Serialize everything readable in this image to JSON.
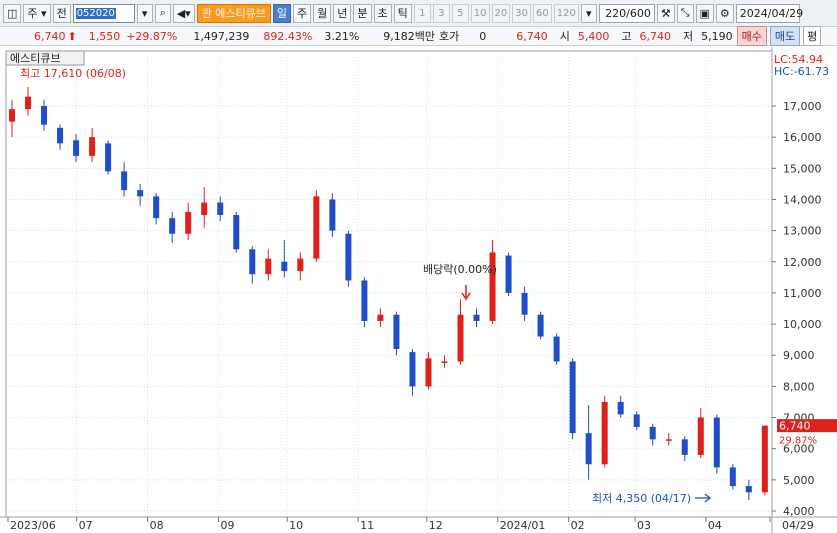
{
  "toolbar": {
    "type_label": "주",
    "market_label": "전",
    "code": "052020",
    "name_badge": "관",
    "name": "에스티큐브",
    "period_buttons": [
      "일",
      "주",
      "월",
      "년",
      "분",
      "초",
      "틱"
    ],
    "interval_buttons": [
      "1",
      "3",
      "5",
      "10",
      "20",
      "30",
      "60",
      "120"
    ],
    "count": "220",
    "count_max": "/600",
    "date": "2024/04/29"
  },
  "infobar": {
    "price": "6,740",
    "change": "1,550",
    "change_pct": "+29.87%",
    "volume": "1,497,239",
    "vol_ratio": "892.43%",
    "turnover": "3.21%",
    "amount": "9,182백만",
    "hoga_label": "호가",
    "hoga_value": "0",
    "current": "6,740",
    "open_label": "시",
    "open": "5,400",
    "high_label": "고",
    "high": "6,740",
    "low_label": "저",
    "low": "5,190",
    "buy_label": "매수",
    "sell_label": "매도",
    "more_label": "평"
  },
  "chart_data": {
    "type": "candlestick",
    "title": "에스티큐브",
    "ylim": [
      4000,
      17610
    ],
    "y_ticks": [
      4000,
      5000,
      6000,
      7000,
      8000,
      9000,
      10000,
      11000,
      12000,
      13000,
      14000,
      15000,
      16000,
      17000
    ],
    "y_tick_labels": [
      "4,000",
      "5,000",
      "6,000",
      "7,000",
      "8,000",
      "9,000",
      "10,000",
      "11,000",
      "12,000",
      "13,000",
      "14,000",
      "15,000",
      "16,000",
      "17,000"
    ],
    "x_labels": [
      "2023/06",
      "07",
      "08",
      "09",
      "10",
      "11",
      "12",
      "2024/01",
      "02",
      "03",
      "04",
      "04/29"
    ],
    "x_label_dates": [
      "2023-06-01",
      "2023-07-01",
      "2023-08-01",
      "2023-09-01",
      "2023-10-01",
      "2023-11-01",
      "2023-12-01",
      "2024-01-01",
      "2024-02-01",
      "2024-03-01",
      "2024-04-01",
      "2024-04-29"
    ],
    "grid": true,
    "up_color": "#e0201a",
    "down_color": "#1f4fc8",
    "candles": [
      {
        "date": "2023-06-01",
        "o": 16500,
        "h": 17200,
        "l": 16000,
        "c": 16900
      },
      {
        "date": "2023-06-08",
        "o": 16900,
        "h": 17610,
        "l": 16700,
        "c": 17300
      },
      {
        "date": "2023-06-15",
        "o": 17000,
        "h": 17200,
        "l": 16200,
        "c": 16400
      },
      {
        "date": "2023-06-22",
        "o": 16300,
        "h": 16400,
        "l": 15600,
        "c": 15800
      },
      {
        "date": "2023-06-29",
        "o": 15900,
        "h": 16100,
        "l": 15200,
        "c": 15400
      },
      {
        "date": "2023-07-06",
        "o": 15400,
        "h": 16300,
        "l": 15200,
        "c": 16000
      },
      {
        "date": "2023-07-13",
        "o": 15800,
        "h": 15900,
        "l": 14800,
        "c": 14900
      },
      {
        "date": "2023-07-20",
        "o": 14900,
        "h": 15200,
        "l": 14100,
        "c": 14300
      },
      {
        "date": "2023-07-27",
        "o": 14300,
        "h": 14500,
        "l": 13800,
        "c": 14100
      },
      {
        "date": "2023-08-03",
        "o": 14100,
        "h": 14200,
        "l": 13200,
        "c": 13400
      },
      {
        "date": "2023-08-10",
        "o": 13400,
        "h": 13600,
        "l": 12600,
        "c": 12900
      },
      {
        "date": "2023-08-17",
        "o": 12900,
        "h": 13900,
        "l": 12700,
        "c": 13600
      },
      {
        "date": "2023-08-24",
        "o": 13500,
        "h": 14400,
        "l": 13100,
        "c": 13900
      },
      {
        "date": "2023-08-31",
        "o": 13900,
        "h": 14100,
        "l": 13300,
        "c": 13500
      },
      {
        "date": "2023-09-07",
        "o": 13500,
        "h": 13600,
        "l": 12300,
        "c": 12400
      },
      {
        "date": "2023-09-14",
        "o": 12400,
        "h": 12500,
        "l": 11300,
        "c": 11600
      },
      {
        "date": "2023-09-21",
        "o": 11600,
        "h": 12400,
        "l": 11400,
        "c": 12100
      },
      {
        "date": "2023-09-28",
        "o": 12000,
        "h": 12700,
        "l": 11500,
        "c": 11700
      },
      {
        "date": "2023-10-05",
        "o": 11700,
        "h": 12300,
        "l": 11400,
        "c": 12100
      },
      {
        "date": "2023-10-12",
        "o": 12100,
        "h": 14300,
        "l": 12000,
        "c": 14100
      },
      {
        "date": "2023-10-19",
        "o": 14000,
        "h": 14200,
        "l": 12800,
        "c": 13000
      },
      {
        "date": "2023-10-26",
        "o": 12900,
        "h": 13000,
        "l": 11200,
        "c": 11400
      },
      {
        "date": "2023-11-02",
        "o": 11400,
        "h": 11500,
        "l": 9900,
        "c": 10100
      },
      {
        "date": "2023-11-09",
        "o": 10100,
        "h": 10500,
        "l": 9900,
        "c": 10300
      },
      {
        "date": "2023-11-16",
        "o": 10300,
        "h": 10400,
        "l": 9000,
        "c": 9200
      },
      {
        "date": "2023-11-23",
        "o": 9100,
        "h": 9200,
        "l": 7700,
        "c": 8000
      },
      {
        "date": "2023-11-30",
        "o": 8000,
        "h": 9100,
        "l": 7900,
        "c": 8900
      },
      {
        "date": "2023-12-07",
        "o": 8800,
        "h": 9000,
        "l": 8600,
        "c": 8800
      },
      {
        "date": "2023-12-14",
        "o": 8800,
        "h": 10800,
        "l": 8700,
        "c": 10300
      },
      {
        "date": "2023-12-21",
        "o": 10300,
        "h": 10500,
        "l": 9900,
        "c": 10100
      },
      {
        "date": "2023-12-28",
        "o": 10100,
        "h": 12700,
        "l": 10000,
        "c": 12300
      },
      {
        "date": "2024-01-04",
        "o": 12200,
        "h": 12300,
        "l": 10900,
        "c": 11000
      },
      {
        "date": "2024-01-11",
        "o": 11000,
        "h": 11200,
        "l": 10100,
        "c": 10300
      },
      {
        "date": "2024-01-18",
        "o": 10300,
        "h": 10400,
        "l": 9500,
        "c": 9600
      },
      {
        "date": "2024-01-25",
        "o": 9600,
        "h": 9700,
        "l": 8700,
        "c": 8800
      },
      {
        "date": "2024-02-01",
        "o": 8800,
        "h": 8900,
        "l": 6300,
        "c": 6500
      },
      {
        "date": "2024-02-08",
        "o": 6500,
        "h": 7400,
        "l": 5000,
        "c": 5500
      },
      {
        "date": "2024-02-15",
        "o": 5500,
        "h": 7700,
        "l": 5400,
        "c": 7500
      },
      {
        "date": "2024-02-22",
        "o": 7500,
        "h": 7700,
        "l": 7000,
        "c": 7100
      },
      {
        "date": "2024-02-29",
        "o": 7100,
        "h": 7200,
        "l": 6600,
        "c": 6700
      },
      {
        "date": "2024-03-07",
        "o": 6700,
        "h": 6800,
        "l": 6100,
        "c": 6300
      },
      {
        "date": "2024-03-14",
        "o": 6300,
        "h": 6500,
        "l": 6100,
        "c": 6300
      },
      {
        "date": "2024-03-21",
        "o": 6300,
        "h": 6400,
        "l": 5600,
        "c": 5800
      },
      {
        "date": "2024-03-28",
        "o": 5800,
        "h": 7300,
        "l": 5700,
        "c": 7000
      },
      {
        "date": "2024-04-04",
        "o": 7000,
        "h": 7100,
        "l": 5200,
        "c": 5400
      },
      {
        "date": "2024-04-11",
        "o": 5400,
        "h": 5500,
        "l": 4700,
        "c": 4800
      },
      {
        "date": "2024-04-18",
        "o": 4800,
        "h": 5000,
        "l": 4350,
        "c": 4600
      },
      {
        "date": "2024-04-25",
        "o": 4600,
        "h": 6740,
        "l": 4500,
        "c": 6740
      }
    ],
    "annotations": {
      "label": "에스티큐브",
      "high": "최고 17,610 (06/08)",
      "low": "최저 4,350 (04/17)",
      "dividend": "배당락(0.00%)"
    },
    "indicators": {
      "lc": "LC:54.94",
      "hc": "HC:-61.73"
    },
    "last_price_label": "6,740",
    "last_change_label": "29.87%",
    "last_price": 6740
  }
}
